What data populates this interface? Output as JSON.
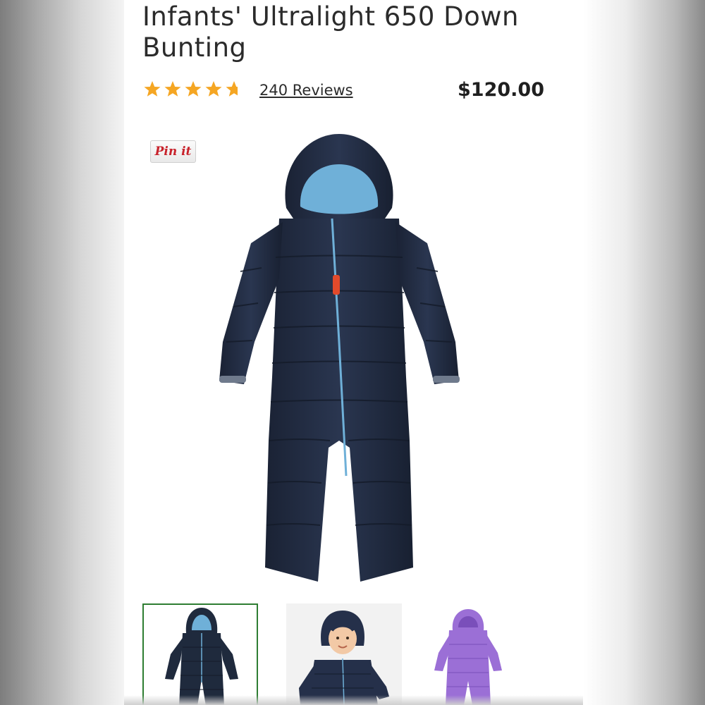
{
  "product": {
    "title": "Infants' Ultralight 650 Down Bunting",
    "rating": 4.7,
    "rating_max": 5,
    "reviews_label": "240 Reviews",
    "price": "$120.00"
  },
  "pin_button": {
    "label": "Pin it"
  },
  "main_image": {
    "icon": "navy-down-bunting-image"
  },
  "thumbnails": [
    {
      "icon": "navy-bunting-thumbnail",
      "selected": true
    },
    {
      "icon": "baby-in-bunting-thumbnail",
      "selected": false
    },
    {
      "icon": "purple-bunting-thumbnail",
      "selected": false
    }
  ],
  "colors": {
    "star": "#f5a623",
    "navy": "#1f2a3d",
    "lining": "#6fb0d8",
    "purple": "#9b6fd6",
    "pin_red": "#c8232c",
    "selected_border": "#2e7d32"
  }
}
